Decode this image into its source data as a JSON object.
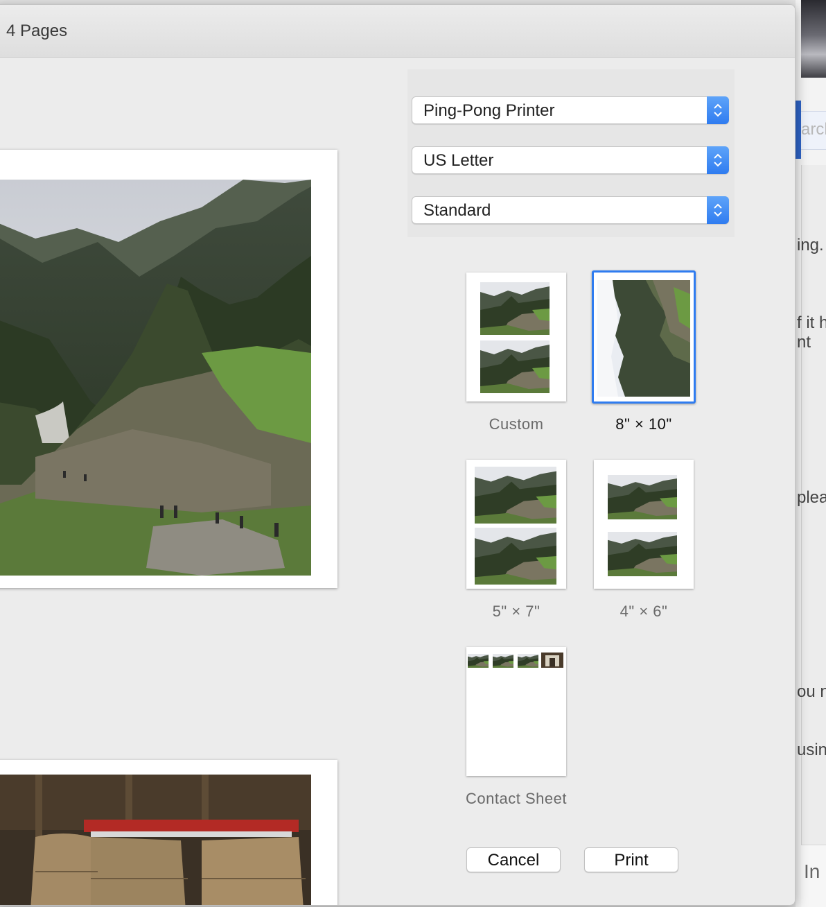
{
  "dialog": {
    "title": "4 Pages"
  },
  "print_settings": {
    "printer": "Ping-Pong Printer",
    "paper_size": "US Letter",
    "quality": "Standard"
  },
  "size_options": [
    {
      "label": "Custom",
      "selected": false
    },
    {
      "label": "8\" × 10\"",
      "selected": true
    },
    {
      "label": "5\" × 7\"",
      "selected": false
    },
    {
      "label": "4\" × 6\"",
      "selected": false
    },
    {
      "label": "Contact Sheet",
      "selected": false
    }
  ],
  "buttons": {
    "cancel": "Cancel",
    "print": "Print"
  },
  "background_app": {
    "search_placeholder": "arch",
    "text_fragments": [
      "ing.",
      "f it h",
      "nt",
      "plea",
      "ou n",
      "usin"
    ],
    "bottom_text": "In"
  },
  "colors": {
    "accent": "#2f7cf0",
    "dialog_bg": "#ececec"
  }
}
